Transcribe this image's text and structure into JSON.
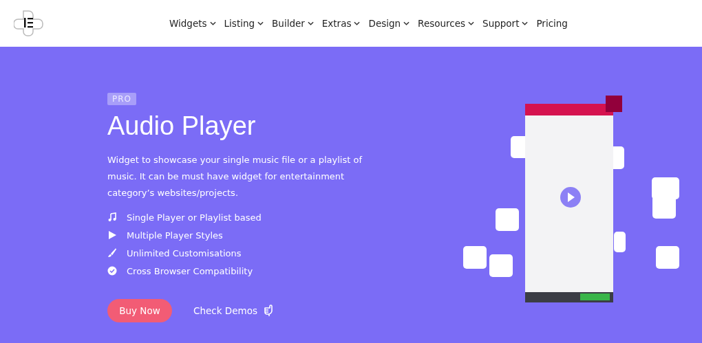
{
  "nav": [
    {
      "label": "Widgets",
      "dropdown": true
    },
    {
      "label": "Listing",
      "dropdown": true
    },
    {
      "label": "Builder",
      "dropdown": true
    },
    {
      "label": "Extras",
      "dropdown": true
    },
    {
      "label": "Design",
      "dropdown": true
    },
    {
      "label": "Resources",
      "dropdown": true
    },
    {
      "label": "Support",
      "dropdown": true
    },
    {
      "label": "Pricing",
      "dropdown": false
    }
  ],
  "hero": {
    "badge": "PRO",
    "title": "Audio Player",
    "description": "Widget to showcase your single music file or a playlist of music. It can be must have widget for entertainment category’s websites/projects.",
    "features": [
      {
        "kind": "music",
        "label": "Single Player or Playlist based"
      },
      {
        "kind": "play",
        "label": "Multiple Player Styles"
      },
      {
        "kind": "brush",
        "label": "Unlimited Customisations"
      },
      {
        "kind": "check",
        "label": "Cross Browser Compatibility"
      }
    ],
    "primary_button": "Buy Now",
    "secondary_link": "Check Demos"
  }
}
